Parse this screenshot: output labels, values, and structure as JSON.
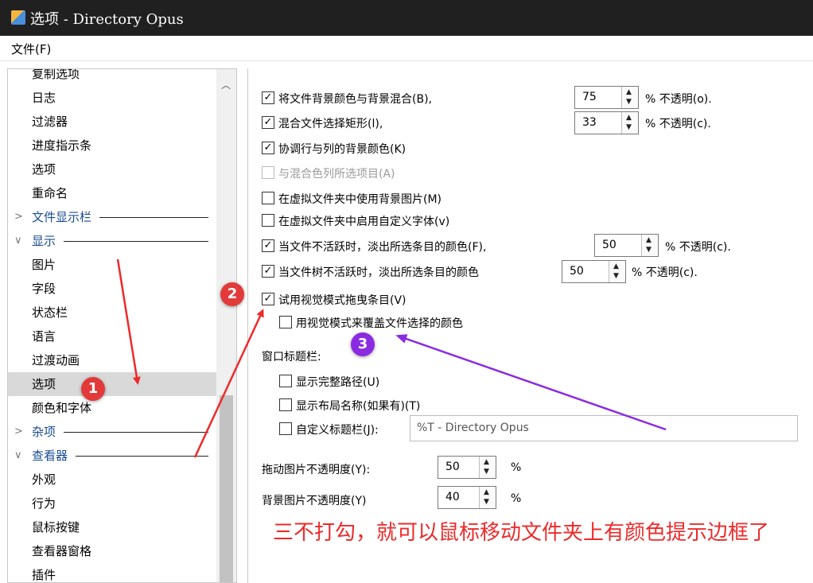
{
  "window": {
    "title": "选项 - Directory Opus",
    "app_icon": "directory-opus-icon"
  },
  "menu": {
    "file": "文件(F)"
  },
  "sidebar": {
    "items": [
      {
        "label": "复制选项",
        "type": "item"
      },
      {
        "label": "日志",
        "type": "item"
      },
      {
        "label": "过滤器",
        "type": "item"
      },
      {
        "label": "进度指示条",
        "type": "item"
      },
      {
        "label": "选项",
        "type": "item"
      },
      {
        "label": "重命名",
        "type": "item"
      },
      {
        "label": "文件显示栏",
        "type": "group",
        "state": "collapsed"
      },
      {
        "label": "显示",
        "type": "group",
        "state": "expanded"
      },
      {
        "label": "图片",
        "type": "item"
      },
      {
        "label": "字段",
        "type": "item"
      },
      {
        "label": "状态栏",
        "type": "item"
      },
      {
        "label": "语言",
        "type": "item"
      },
      {
        "label": "过渡动画",
        "type": "item"
      },
      {
        "label": "选项",
        "type": "item",
        "selected": true
      },
      {
        "label": "颜色和字体",
        "type": "item"
      },
      {
        "label": "杂项",
        "type": "group",
        "state": "collapsed"
      },
      {
        "label": "查看器",
        "type": "group",
        "state": "expanded"
      },
      {
        "label": "外观",
        "type": "item"
      },
      {
        "label": "行为",
        "type": "item"
      },
      {
        "label": "鼠标按键",
        "type": "item"
      },
      {
        "label": "查看器窗格",
        "type": "item"
      },
      {
        "label": "插件",
        "type": "item"
      }
    ]
  },
  "options": {
    "blend_bg": {
      "label": "将文件背景颜色与背景混合(B),",
      "checked": true,
      "value": "75",
      "suffix": "% 不透明(o)."
    },
    "blend_rect": {
      "label": "混合文件选择矩形(l),",
      "checked": true,
      "value": "33",
      "suffix": "% 不透明(c)."
    },
    "coord_rows": {
      "label": "协调行与列的背景颜色(K)",
      "checked": true
    },
    "blend_cols": {
      "label": "与混合色列所选项目(A)",
      "checked": false,
      "disabled": true
    },
    "vf_bg_img": {
      "label": "在虚拟文件夹中使用背景图片(M)",
      "checked": false
    },
    "vf_font": {
      "label": "在虚拟文件夹中启用自定义字体(v)",
      "checked": false
    },
    "fade_file": {
      "label": "当文件不活跃时，淡出所选条目的颜色(F),",
      "checked": true,
      "value": "50",
      "suffix": "% 不透明(c)."
    },
    "fade_tree": {
      "label": "当文件树不活跃时，淡出所选条目的颜色",
      "checked": true,
      "value": "50",
      "suffix": "% 不透明(c)."
    },
    "drag_visual": {
      "label": "试用视觉模式拖曳条目(V)",
      "checked": true
    },
    "visual_override": {
      "label": "用视觉模式来覆盖文件选择的颜色",
      "checked": false
    }
  },
  "window_title_section": {
    "heading": "窗口标题栏:",
    "full_path": {
      "label": "显示完整路径(U)",
      "checked": false
    },
    "layout_name": {
      "label": "显示布局名称(如果有)(T)",
      "checked": false
    },
    "custom_title": {
      "label": "自定义标题栏(J):",
      "checked": false,
      "value": "%T - Directory Opus"
    }
  },
  "opacity": {
    "drag_image": {
      "label": "拖动图片不透明度(Y):",
      "value": "50",
      "unit": "%"
    },
    "bg_image": {
      "label": "背景图片不透明度(Y)",
      "value": "40",
      "unit": "%"
    }
  },
  "annotations": {
    "note": "三不打勾，就可以鼠标移动文件夹上有颜色提示边框了",
    "badge1": "1",
    "badge2": "2",
    "badge3": "3",
    "colors": {
      "red": "#ee2a2a",
      "purple": "#8a2be2"
    }
  }
}
